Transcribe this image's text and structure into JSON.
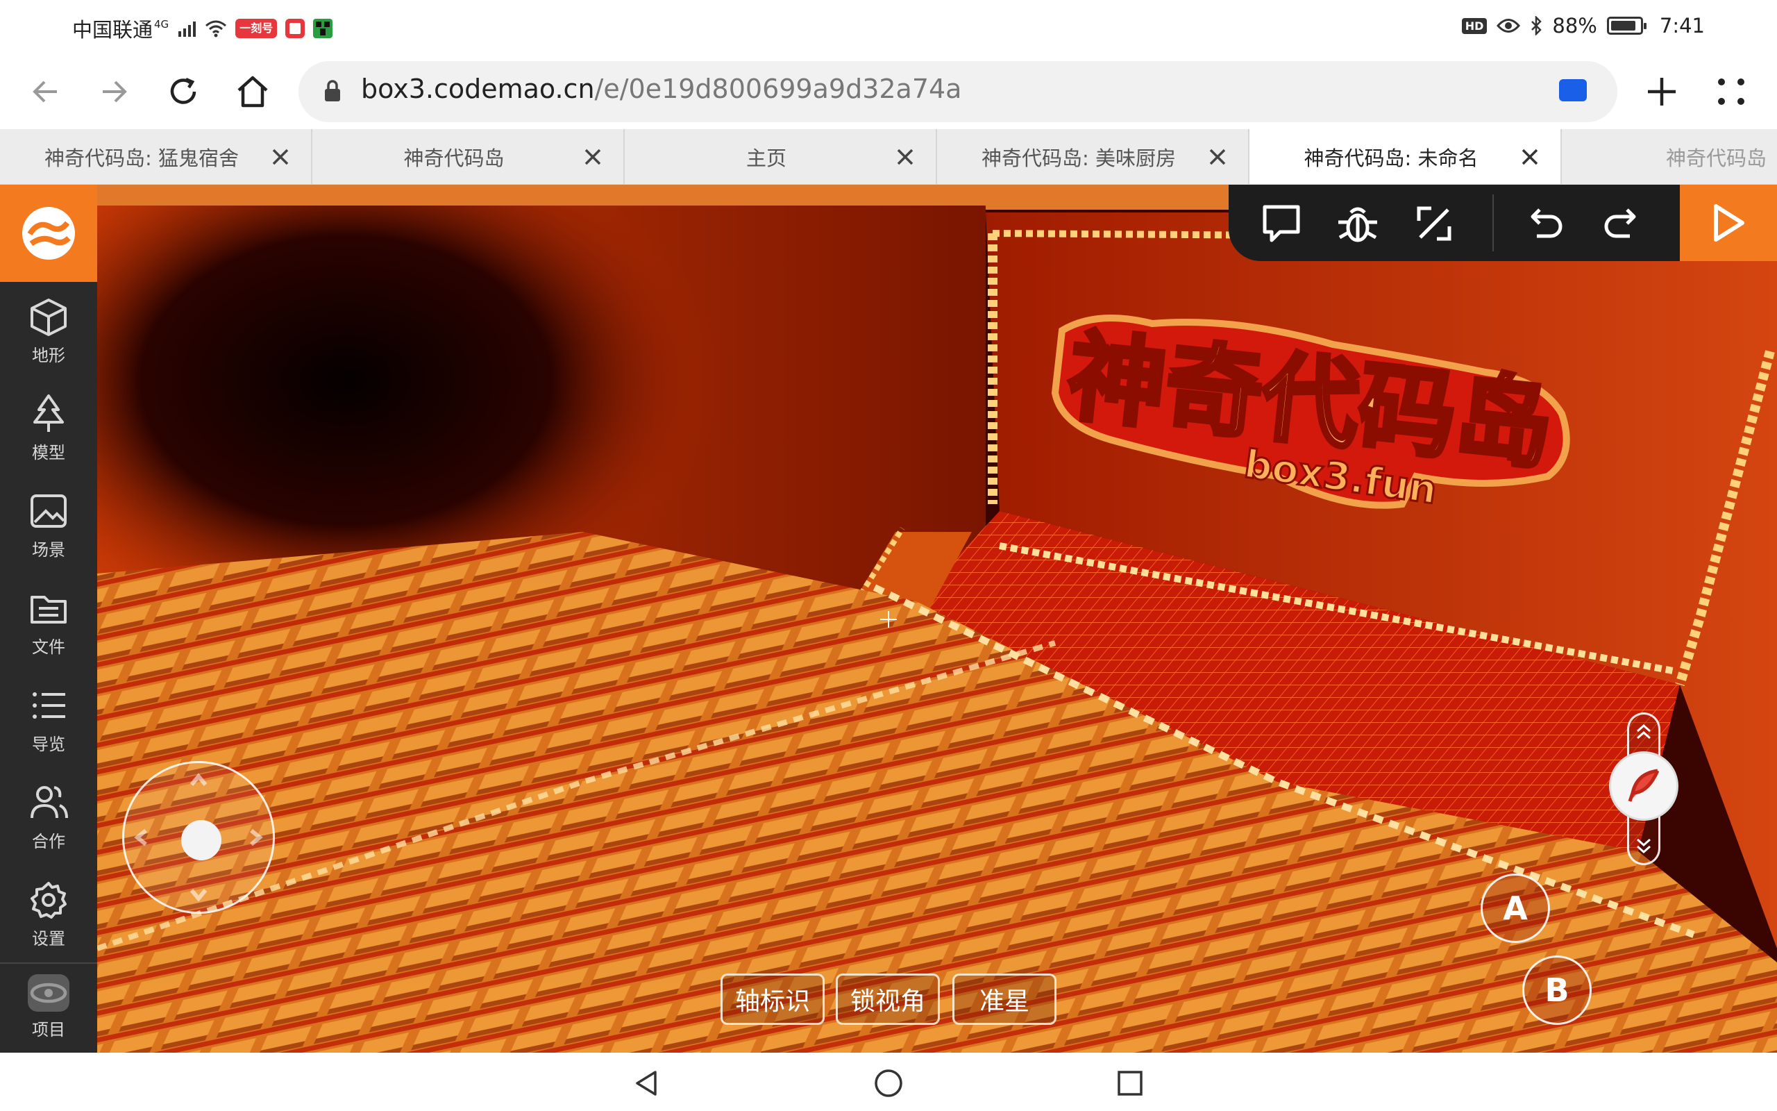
{
  "status_bar": {
    "carrier": "中国联通",
    "network": "4G",
    "battery": "88%",
    "battery_level": 0.88,
    "time": "7:41",
    "hd_badge": "HD",
    "app_tag_red": "一刻号",
    "icons": [
      "signal-icon",
      "wifi-icon",
      "app-icon-red",
      "app-icon-book",
      "app-icon-green",
      "hd-icon",
      "eye-icon",
      "bluetooth-icon",
      "battery-icon"
    ]
  },
  "browser": {
    "url_host": "box3.codemao.cn",
    "url_path": "/e/0e19d800699a9d32a74a",
    "icons": [
      "back-icon",
      "forward-icon",
      "reload-icon",
      "home-icon",
      "lock-icon",
      "cast-icon",
      "new-tab-icon",
      "menu-icon"
    ]
  },
  "tabs": [
    {
      "label": "神奇代码岛: 猛鬼宿舍",
      "active": false
    },
    {
      "label": "神奇代码岛",
      "active": false
    },
    {
      "label": "主页",
      "active": false
    },
    {
      "label": "神奇代码岛: 美味厨房",
      "active": false
    },
    {
      "label": "神奇代码岛: 未命名",
      "active": true
    },
    {
      "label": "神奇代码岛",
      "active": false
    }
  ],
  "sidebar": {
    "items": [
      {
        "label": "地形",
        "icon": "cube-icon"
      },
      {
        "label": "模型",
        "icon": "tree-icon"
      },
      {
        "label": "场景",
        "icon": "image-icon"
      },
      {
        "label": "文件",
        "icon": "folder-icon"
      },
      {
        "label": "导览",
        "icon": "list-icon"
      },
      {
        "label": "合作",
        "icon": "users-icon"
      },
      {
        "label": "设置",
        "icon": "gear-icon"
      },
      {
        "label": "项目",
        "icon": "project-icon"
      }
    ]
  },
  "editor_toolbar": {
    "icons": [
      "chat-icon",
      "debug-bug-icon",
      "fullscreen-icon",
      "undo-icon",
      "redo-icon",
      "play-icon"
    ],
    "accent": "#f47a1f"
  },
  "scene": {
    "sign_text": "神奇代码岛",
    "sign_subtext": "box3.fun"
  },
  "controls": {
    "toggles": [
      "轴标识",
      "锁视角",
      "准星"
    ],
    "action_a": "A",
    "action_b": "B",
    "fly_icon": "feather-icon"
  },
  "nav": {
    "icons": [
      "nav-back-icon",
      "nav-home-icon",
      "nav-recents-icon"
    ]
  }
}
